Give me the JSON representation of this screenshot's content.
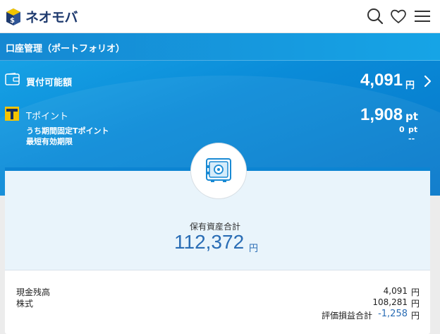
{
  "header": {
    "logo_text": "ネオモバ",
    "icons": [
      "search-icon",
      "heart-icon",
      "menu-icon"
    ]
  },
  "page_title": "口座管理（ポートフォリオ）",
  "buying_power": {
    "label": "買付可能額",
    "amount": "4,091",
    "unit": "円",
    "icon": "wallet-icon"
  },
  "tpoint": {
    "label": "Tポイント",
    "amount": "1,908",
    "unit": "pt",
    "fixed_label": "うち期間固定Tポイント",
    "fixed_value": "0",
    "fixed_unit": "pt",
    "expiry_label": "最短有効期限",
    "expiry_value": "--",
    "icon": "tpoint-logo-icon"
  },
  "total_assets": {
    "label": "保有資産合計",
    "amount": "112,372",
    "unit": "円",
    "icon": "safe-icon"
  },
  "breakdown": [
    {
      "label": "現金残高",
      "value": "4,091",
      "unit": "円"
    },
    {
      "label": "株式",
      "value": "108,281",
      "unit": "円"
    }
  ],
  "unrealized": {
    "label": "評価損益合計",
    "value": "-1,258",
    "unit": "円",
    "color": "#2a6db5"
  },
  "colors": {
    "accent": "#0c84d2",
    "header_bg": "#ffffff",
    "total_text": "#2a6db5",
    "tpoint_yellow": "#f5c400",
    "logo_navy": "#1e3a6e"
  }
}
